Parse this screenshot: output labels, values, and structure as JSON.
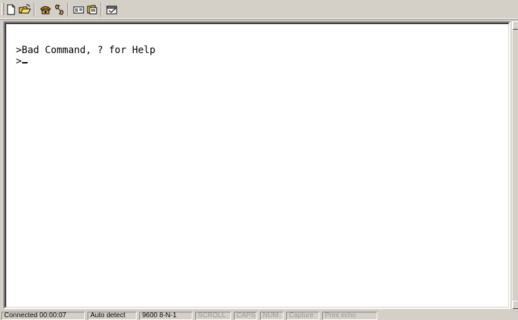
{
  "toolbar": {
    "buttons": [
      {
        "name": "new-icon"
      },
      {
        "name": "open-icon"
      },
      {
        "name": "connect-icon"
      },
      {
        "name": "disconnect-icon"
      },
      {
        "name": "send-icon"
      },
      {
        "name": "receive-icon"
      },
      {
        "name": "properties-icon"
      }
    ]
  },
  "terminal": {
    "lines": [
      ">Bad Command, ? for Help",
      ">"
    ]
  },
  "status": {
    "connected": "Connected 00:00:07",
    "detect": "Auto detect",
    "settings": "9600 8-N-1",
    "scroll": "SCROLL",
    "caps": "CAPS",
    "num": "NUM",
    "capture": "Capture",
    "print_echo": "Print echo"
  }
}
